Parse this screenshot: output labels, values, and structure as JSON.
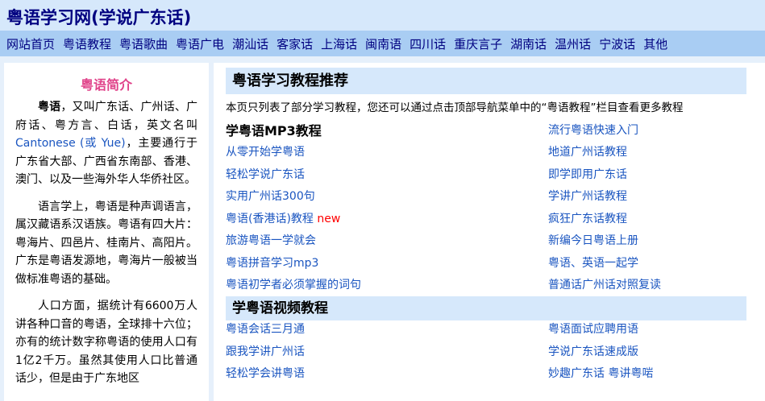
{
  "site": {
    "title": "粤语学习网(学说广东话)"
  },
  "nav": [
    "网站首页",
    "粤语教程",
    "粤语歌曲",
    "粤语广电",
    "潮汕话",
    "客家话",
    "上海话",
    "闽南语",
    "四川话",
    "重庆言子",
    "湖南话",
    "温州话",
    "宁波话",
    "其他"
  ],
  "sidebar": {
    "title": "粤语简介",
    "p1_bold": "粤语",
    "p1_a": "，又叫广东话、广州话、广府话、粤方言、白话，英文名叫",
    "p1_en": "Cantonese (或 Yue)",
    "p1_b": "，主要通行于广东省大部、广西省东南部、香港、澳门、以及一些海外华人华侨社区。",
    "p2": "语言学上，粤语是种声调语言，属汉藏语系汉语族。粤语有四大片：粤海片、四邑片、桂南片、高阳片。广东是粤语发源地，粤海片一般被当做标准粤语的基础。",
    "p3": "人口方面，据统计有6600万人讲各种口音的粤语，全球排十六位；亦有的统计数字称粤语的使用人口有1亿2千万。虽然其使用人口比普通话少，但是由于广东地区"
  },
  "main": {
    "section1_title": "粤语学习教程推荐",
    "note": "本页只列表了部分学习教程，您还可以通过点击顶部导航菜单中的“粤语教程”栏目查看更多教程",
    "mp3_title": "学粤语MP3教程",
    "left_links": [
      "从零开始学粤语",
      "轻松学说广东话",
      "实用广州话300句",
      "粤语(香港话)教程",
      "旅游粤语一学就会",
      "粤语拼音学习mp3",
      "粤语初学者必须掌握的词句"
    ],
    "new_badge": "new",
    "right_links": [
      "流行粤语快速入门",
      "地道广州话教程",
      "即学即用广东话",
      "学讲广州话教程",
      "疯狂广东话教程",
      "新编今日粤语上册",
      "粤语、英语一起学",
      "普通话广州话对照复读"
    ],
    "section2_title": "学粤语视频教程",
    "video_left": [
      "粤语会话三月通",
      "跟我学讲广州话",
      "轻松学会讲粤语"
    ],
    "video_right": [
      "粤语面试应聘用语",
      "学说广东话速成版",
      "妙趣广东话 粤讲粤啱"
    ]
  }
}
